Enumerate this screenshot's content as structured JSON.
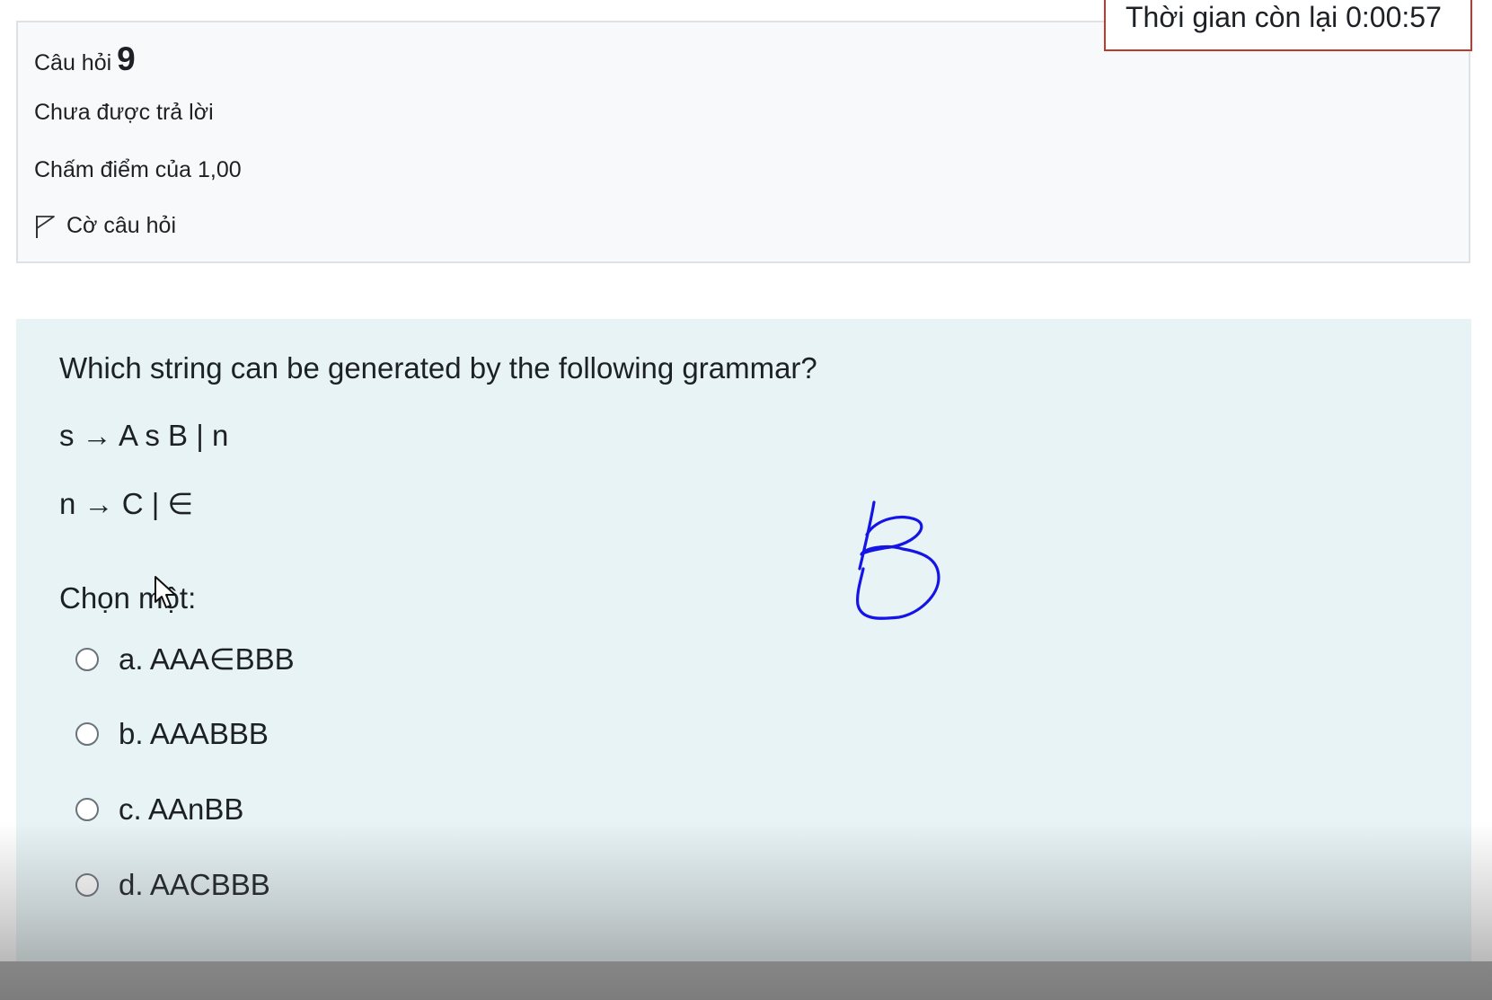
{
  "timer": {
    "label": "Thời gian còn lại 0:00:57"
  },
  "info": {
    "question_label": "Câu hỏi",
    "question_number": "9",
    "state": "Chưa được trả lời",
    "grade": "Chấm điểm của 1,00",
    "flag_label": "Cờ câu hỏi"
  },
  "question": {
    "text": "Which string can be generated by the following grammar?",
    "rule_1": "s → A s B | n",
    "rule_2": "n → C | ∈",
    "prompt": "Chọn một:",
    "options": [
      {
        "label": "a. AAA∈BBB",
        "selected": false
      },
      {
        "label": "b. AAABBB",
        "selected": false
      },
      {
        "label": "c. AAnBB",
        "selected": false
      },
      {
        "label": "d. AACBBB",
        "selected": false
      }
    ]
  },
  "annotation": {
    "handwritten_letter": "B",
    "ink_color": "#1414e6"
  },
  "colors": {
    "content_background": "#e7f3f5",
    "info_background": "#f8f9fa",
    "timer_border": "#c0392b"
  },
  "icons": {
    "flag": "flag-outline-icon",
    "cursor": "mouse-pointer-icon"
  }
}
